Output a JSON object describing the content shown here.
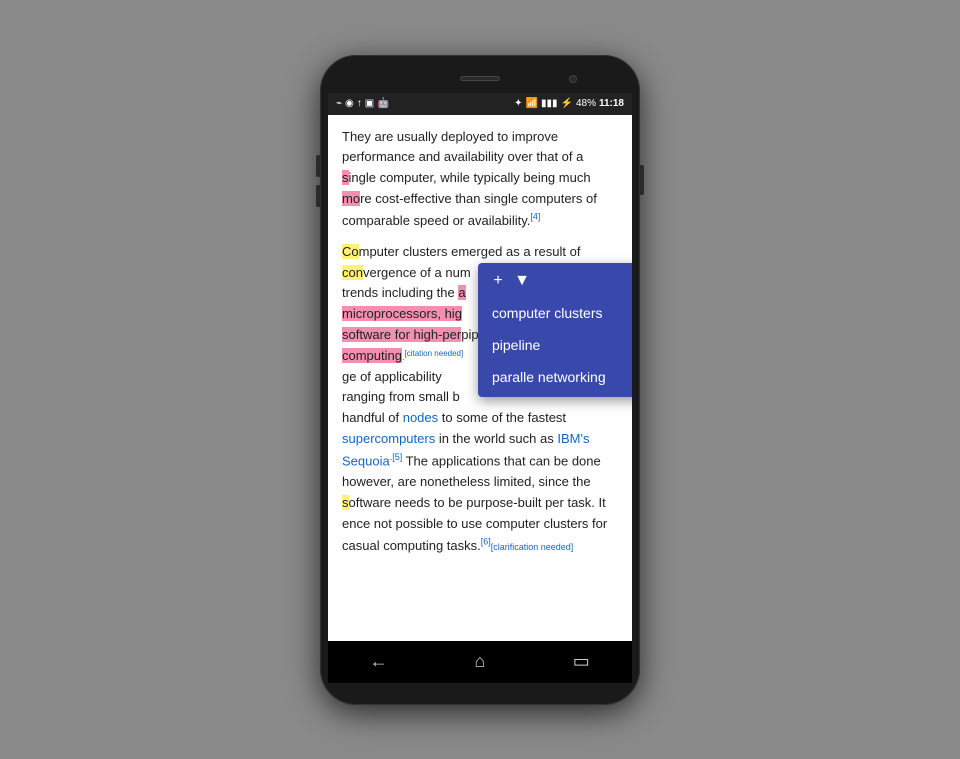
{
  "phone": {
    "status_bar": {
      "time": "11:18",
      "battery": "48%",
      "icons_left": [
        "usb-icon",
        "navigation-icon",
        "upload-icon",
        "image-icon",
        "android-icon"
      ],
      "icons_right": [
        "bluetooth-icon",
        "wifi-icon",
        "signal-icon",
        "battery-icon"
      ]
    },
    "content": {
      "paragraph1": "They are usually deployed to improve performance and availability over that of a single computer, while typically being much more cost-effective than single computers of comparable speed or availability.",
      "paragraph1_ref": "[4]",
      "paragraph2_start": "Computer clusters emerged as a result of convergence of a num",
      "paragraph2_trends": "trends including the a",
      "paragraph2_micro": "microprocessors, hig",
      "paragraph2_software": "software for high-per",
      "paragraph2_pipeline": "pipeline",
      "paragraph2_computing": "computing",
      "paragraph2_citation": "[citation needed]",
      "paragraph2_range": "ge of applicability",
      "paragraph2_ranging": "ranging from small b",
      "paragraph2_nodes": "nodes",
      "paragraph2_fastest": "to some of the fastest",
      "paragraph2_supercomputers": "supercomputers",
      "paragraph2_ibm": "IBM's Sequoia",
      "paragraph2_ref5": "[5]",
      "paragraph3": "The applications that can be done however, are nonetheless limited, since the software needs to be purpose-built per task. It ence not possible to use computer clusters for casual computing tasks.",
      "paragraph3_ref": "[6]",
      "paragraph3_clarification": "[clarification needed]"
    },
    "popup": {
      "btn_plus": "+",
      "btn_down": "▼",
      "btn_close": "✕",
      "items": [
        "computer clusters",
        "pipeline",
        "paralle networking"
      ]
    },
    "nav": {
      "back": "←",
      "home": "⌂",
      "recents": "▭"
    }
  }
}
